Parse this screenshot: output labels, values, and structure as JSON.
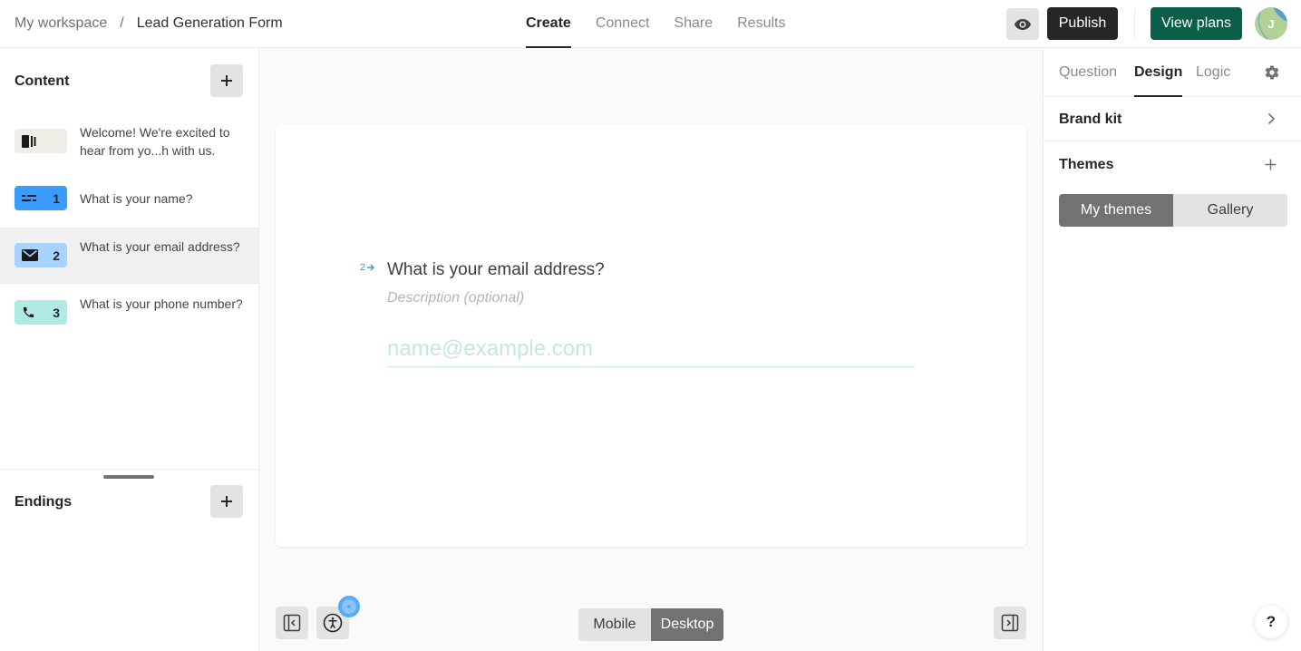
{
  "header": {
    "breadcrumb": {
      "workspace": "My workspace",
      "separator": "/",
      "form_name": "Lead Generation Form"
    },
    "tabs": [
      {
        "label": "Create",
        "active": true
      },
      {
        "label": "Connect",
        "active": false
      },
      {
        "label": "Share",
        "active": false
      },
      {
        "label": "Results",
        "active": false
      }
    ],
    "preview_icon": "eye-icon",
    "publish_label": "Publish",
    "view_plans_label": "View plans",
    "avatar_initial": "J",
    "colors": {
      "publish_bg": "#262627",
      "view_plans_bg": "#0b5f4a",
      "avatar_bg": "#b3d197"
    }
  },
  "left_panel": {
    "content_title": "Content",
    "add_icon": "plus-icon",
    "blocks": [
      {
        "type": "welcome",
        "icon": "welcome-screen-icon",
        "number": "",
        "text": "Welcome! We're excited to hear from yo...h with us.",
        "badge_color": "#f0ece6",
        "selected": false
      },
      {
        "type": "short-text",
        "icon": "short-text-icon",
        "number": "1",
        "text": "What is your name?",
        "badge_color": "#3b9cff",
        "selected": false
      },
      {
        "type": "email",
        "icon": "envelope-icon",
        "number": "2",
        "text": "What is your email address?",
        "badge_color": "#a8d2ff",
        "selected": true
      },
      {
        "type": "phone",
        "icon": "phone-icon",
        "number": "3",
        "text": "What is your phone number?",
        "badge_color": "#b0ebe3",
        "selected": false
      }
    ],
    "endings_title": "Endings"
  },
  "canvas": {
    "question_number": "2",
    "question_title": "What is your email address?",
    "description_placeholder": "Description (optional)",
    "answer_placeholder": "name@example.com",
    "accent_color": "#37a3a4",
    "device_options": [
      {
        "label": "Mobile",
        "active": false
      },
      {
        "label": "Desktop",
        "active": true
      }
    ]
  },
  "right_panel": {
    "tabs": [
      {
        "label": "Question",
        "active": false
      },
      {
        "label": "Design",
        "active": true
      },
      {
        "label": "Logic",
        "active": false
      }
    ],
    "settings_icon": "gear-icon",
    "brand_kit_label": "Brand kit",
    "themes_label": "Themes",
    "theme_options": [
      {
        "label": "My themes",
        "active": true
      },
      {
        "label": "Gallery",
        "active": false
      }
    ],
    "help_label": "?"
  }
}
